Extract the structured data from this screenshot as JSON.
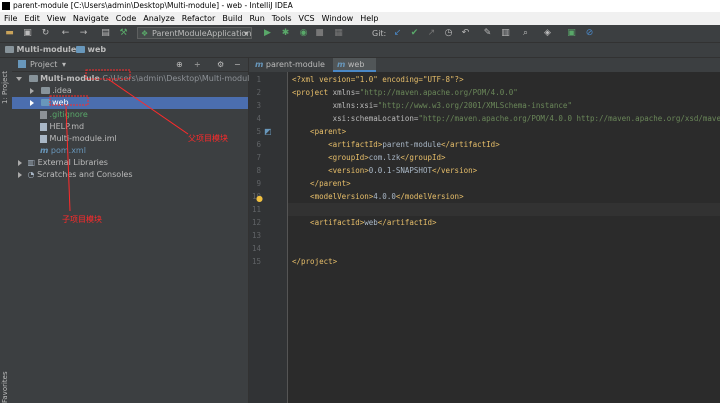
{
  "window": {
    "title": "parent-module [C:\\Users\\admin\\Desktop\\Multi-module] - web - IntelliJ IDEA"
  },
  "menu": [
    "File",
    "Edit",
    "View",
    "Navigate",
    "Code",
    "Analyze",
    "Refactor",
    "Build",
    "Run",
    "Tools",
    "VCS",
    "Window",
    "Help"
  ],
  "toolbar": {
    "run_config": "ParentModuleApplication",
    "git_label": "Git:"
  },
  "breadcrumb": [
    "Multi-module",
    "web"
  ],
  "project_panel": {
    "title": "Project",
    "stripe_project": "1: Project",
    "stripe_favorites": "Favorites",
    "tree": [
      {
        "label": "Multi-module",
        "path": "C:\\Users\\admin\\Desktop\\Multi-module"
      },
      {
        "label": ".idea"
      },
      {
        "label": "web"
      },
      {
        "label": ".gitignore"
      },
      {
        "label": "HELP.md"
      },
      {
        "label": "Multi-module.iml"
      },
      {
        "label": "pom.xml"
      },
      {
        "label": "External Libraries"
      },
      {
        "label": "Scratches and Consoles"
      }
    ]
  },
  "tabs": [
    {
      "label": "parent-module"
    },
    {
      "label": "web"
    }
  ],
  "annotations": {
    "parent": "父项目模块",
    "child": "子项目模块"
  },
  "code_lines": [
    [
      "<?xml version=\"1.0\" encoding=\"UTF-8\"?>"
    ],
    [
      "<project",
      " xmlns=",
      "\"http://maven.apache.org/POM/4.0.0\""
    ],
    [
      "         xmlns:xsi=",
      "\"http://www.w3.org/2001/XMLSchema-instance\""
    ],
    [
      "         xsi:schemaLocation=",
      "\"http://maven.apache.org/POM/4.0.0 http://maven.apache.org/xsd/maven"
    ],
    [
      "    <parent>"
    ],
    [
      "        <artifactId>",
      "parent-module",
      "</artifactId>"
    ],
    [
      "        <groupId>",
      "com.lzk",
      "</groupId>"
    ],
    [
      "        <version>",
      "0.0.1-SNAPSHOT",
      "</version>"
    ],
    [
      "    </parent>"
    ],
    [
      "    <modelVersion>",
      "4.0.0",
      "</modelVersion>"
    ],
    [
      ""
    ],
    [
      "    <artifactId>",
      "web",
      "</artifactId>"
    ],
    [
      ""
    ],
    [
      ""
    ],
    [
      "</project>"
    ]
  ]
}
